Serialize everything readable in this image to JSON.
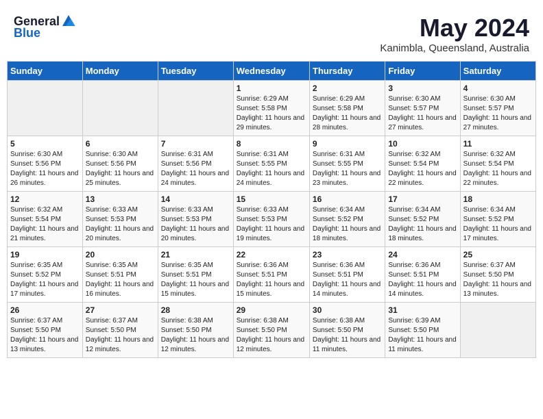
{
  "header": {
    "logo_general": "General",
    "logo_blue": "Blue",
    "title": "May 2024",
    "subtitle": "Kanimbla, Queensland, Australia"
  },
  "weekdays": [
    "Sunday",
    "Monday",
    "Tuesday",
    "Wednesday",
    "Thursday",
    "Friday",
    "Saturday"
  ],
  "weeks": [
    [
      {
        "num": "",
        "info": ""
      },
      {
        "num": "",
        "info": ""
      },
      {
        "num": "",
        "info": ""
      },
      {
        "num": "1",
        "info": "Sunrise: 6:29 AM\nSunset: 5:58 PM\nDaylight: 11 hours and 29 minutes."
      },
      {
        "num": "2",
        "info": "Sunrise: 6:29 AM\nSunset: 5:58 PM\nDaylight: 11 hours and 28 minutes."
      },
      {
        "num": "3",
        "info": "Sunrise: 6:30 AM\nSunset: 5:57 PM\nDaylight: 11 hours and 27 minutes."
      },
      {
        "num": "4",
        "info": "Sunrise: 6:30 AM\nSunset: 5:57 PM\nDaylight: 11 hours and 27 minutes."
      }
    ],
    [
      {
        "num": "5",
        "info": "Sunrise: 6:30 AM\nSunset: 5:56 PM\nDaylight: 11 hours and 26 minutes."
      },
      {
        "num": "6",
        "info": "Sunrise: 6:30 AM\nSunset: 5:56 PM\nDaylight: 11 hours and 25 minutes."
      },
      {
        "num": "7",
        "info": "Sunrise: 6:31 AM\nSunset: 5:56 PM\nDaylight: 11 hours and 24 minutes."
      },
      {
        "num": "8",
        "info": "Sunrise: 6:31 AM\nSunset: 5:55 PM\nDaylight: 11 hours and 24 minutes."
      },
      {
        "num": "9",
        "info": "Sunrise: 6:31 AM\nSunset: 5:55 PM\nDaylight: 11 hours and 23 minutes."
      },
      {
        "num": "10",
        "info": "Sunrise: 6:32 AM\nSunset: 5:54 PM\nDaylight: 11 hours and 22 minutes."
      },
      {
        "num": "11",
        "info": "Sunrise: 6:32 AM\nSunset: 5:54 PM\nDaylight: 11 hours and 22 minutes."
      }
    ],
    [
      {
        "num": "12",
        "info": "Sunrise: 6:32 AM\nSunset: 5:54 PM\nDaylight: 11 hours and 21 minutes."
      },
      {
        "num": "13",
        "info": "Sunrise: 6:33 AM\nSunset: 5:53 PM\nDaylight: 11 hours and 20 minutes."
      },
      {
        "num": "14",
        "info": "Sunrise: 6:33 AM\nSunset: 5:53 PM\nDaylight: 11 hours and 20 minutes."
      },
      {
        "num": "15",
        "info": "Sunrise: 6:33 AM\nSunset: 5:53 PM\nDaylight: 11 hours and 19 minutes."
      },
      {
        "num": "16",
        "info": "Sunrise: 6:34 AM\nSunset: 5:52 PM\nDaylight: 11 hours and 18 minutes."
      },
      {
        "num": "17",
        "info": "Sunrise: 6:34 AM\nSunset: 5:52 PM\nDaylight: 11 hours and 18 minutes."
      },
      {
        "num": "18",
        "info": "Sunrise: 6:34 AM\nSunset: 5:52 PM\nDaylight: 11 hours and 17 minutes."
      }
    ],
    [
      {
        "num": "19",
        "info": "Sunrise: 6:35 AM\nSunset: 5:52 PM\nDaylight: 11 hours and 17 minutes."
      },
      {
        "num": "20",
        "info": "Sunrise: 6:35 AM\nSunset: 5:51 PM\nDaylight: 11 hours and 16 minutes."
      },
      {
        "num": "21",
        "info": "Sunrise: 6:35 AM\nSunset: 5:51 PM\nDaylight: 11 hours and 15 minutes."
      },
      {
        "num": "22",
        "info": "Sunrise: 6:36 AM\nSunset: 5:51 PM\nDaylight: 11 hours and 15 minutes."
      },
      {
        "num": "23",
        "info": "Sunrise: 6:36 AM\nSunset: 5:51 PM\nDaylight: 11 hours and 14 minutes."
      },
      {
        "num": "24",
        "info": "Sunrise: 6:36 AM\nSunset: 5:51 PM\nDaylight: 11 hours and 14 minutes."
      },
      {
        "num": "25",
        "info": "Sunrise: 6:37 AM\nSunset: 5:50 PM\nDaylight: 11 hours and 13 minutes."
      }
    ],
    [
      {
        "num": "26",
        "info": "Sunrise: 6:37 AM\nSunset: 5:50 PM\nDaylight: 11 hours and 13 minutes."
      },
      {
        "num": "27",
        "info": "Sunrise: 6:37 AM\nSunset: 5:50 PM\nDaylight: 11 hours and 12 minutes."
      },
      {
        "num": "28",
        "info": "Sunrise: 6:38 AM\nSunset: 5:50 PM\nDaylight: 11 hours and 12 minutes."
      },
      {
        "num": "29",
        "info": "Sunrise: 6:38 AM\nSunset: 5:50 PM\nDaylight: 11 hours and 12 minutes."
      },
      {
        "num": "30",
        "info": "Sunrise: 6:38 AM\nSunset: 5:50 PM\nDaylight: 11 hours and 11 minutes."
      },
      {
        "num": "31",
        "info": "Sunrise: 6:39 AM\nSunset: 5:50 PM\nDaylight: 11 hours and 11 minutes."
      },
      {
        "num": "",
        "info": ""
      }
    ]
  ]
}
